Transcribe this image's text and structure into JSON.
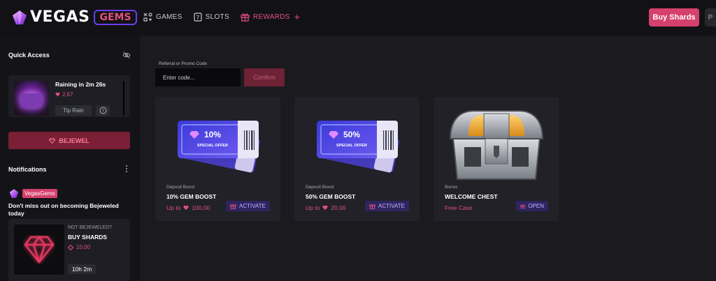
{
  "header": {
    "logo_text": "VEGAS",
    "logo_badge": "GEMS",
    "nav": [
      {
        "label": "GAMES",
        "icon": "games-icon"
      },
      {
        "label": "SLOTS",
        "icon": "slots-icon"
      },
      {
        "label": "REWARDS",
        "icon": "gift-icon"
      }
    ],
    "nav_plus": "+",
    "buy_shards": "Buy Shards",
    "extra": "P"
  },
  "sidebar": {
    "quick_access": "Quick Access",
    "rain": {
      "title": "Raining in 2m 26s",
      "amount": "2,67",
      "tip_label": "Tip Rain",
      "help": "?"
    },
    "bejewel_label": "BEJEWEL",
    "notifications_title": "Notifications",
    "notification": {
      "badge": "VegasGems",
      "message": "Don't miss out on becoming Bejeweled today",
      "card": {
        "label": "NOT BEJEWELED?",
        "title": "BUY SHARDS",
        "amount": "10,00",
        "timer": "10h 2m"
      }
    }
  },
  "promo": {
    "label": "Referral or Promo Code",
    "placeholder": "Enter code...",
    "confirm": "Confirm"
  },
  "cards": [
    {
      "type": "Deposit Boost",
      "title": "10% GEM BOOST",
      "amount_prefix": "Up to",
      "amount": "100,00",
      "button": "ACTIVATE",
      "ticket_percent": "10%",
      "ticket_text": "SPECIAL OFFER"
    },
    {
      "type": "Deposit Boost",
      "title": "50% GEM BOOST",
      "amount_prefix": "Up to",
      "amount": "20,00",
      "button": "ACTIVATE",
      "ticket_percent": "50%",
      "ticket_text": "SPECIAL OFFER"
    },
    {
      "type": "Bonus",
      "title": "WELCOME CHEST",
      "amount_prefix": "Free Case",
      "button": "OPEN"
    }
  ],
  "colors": {
    "accent": "#d6406c",
    "accent_text": "#e2527d",
    "purple": "#6a3df0",
    "bg": "#1a1a1f",
    "card": "#212127"
  }
}
